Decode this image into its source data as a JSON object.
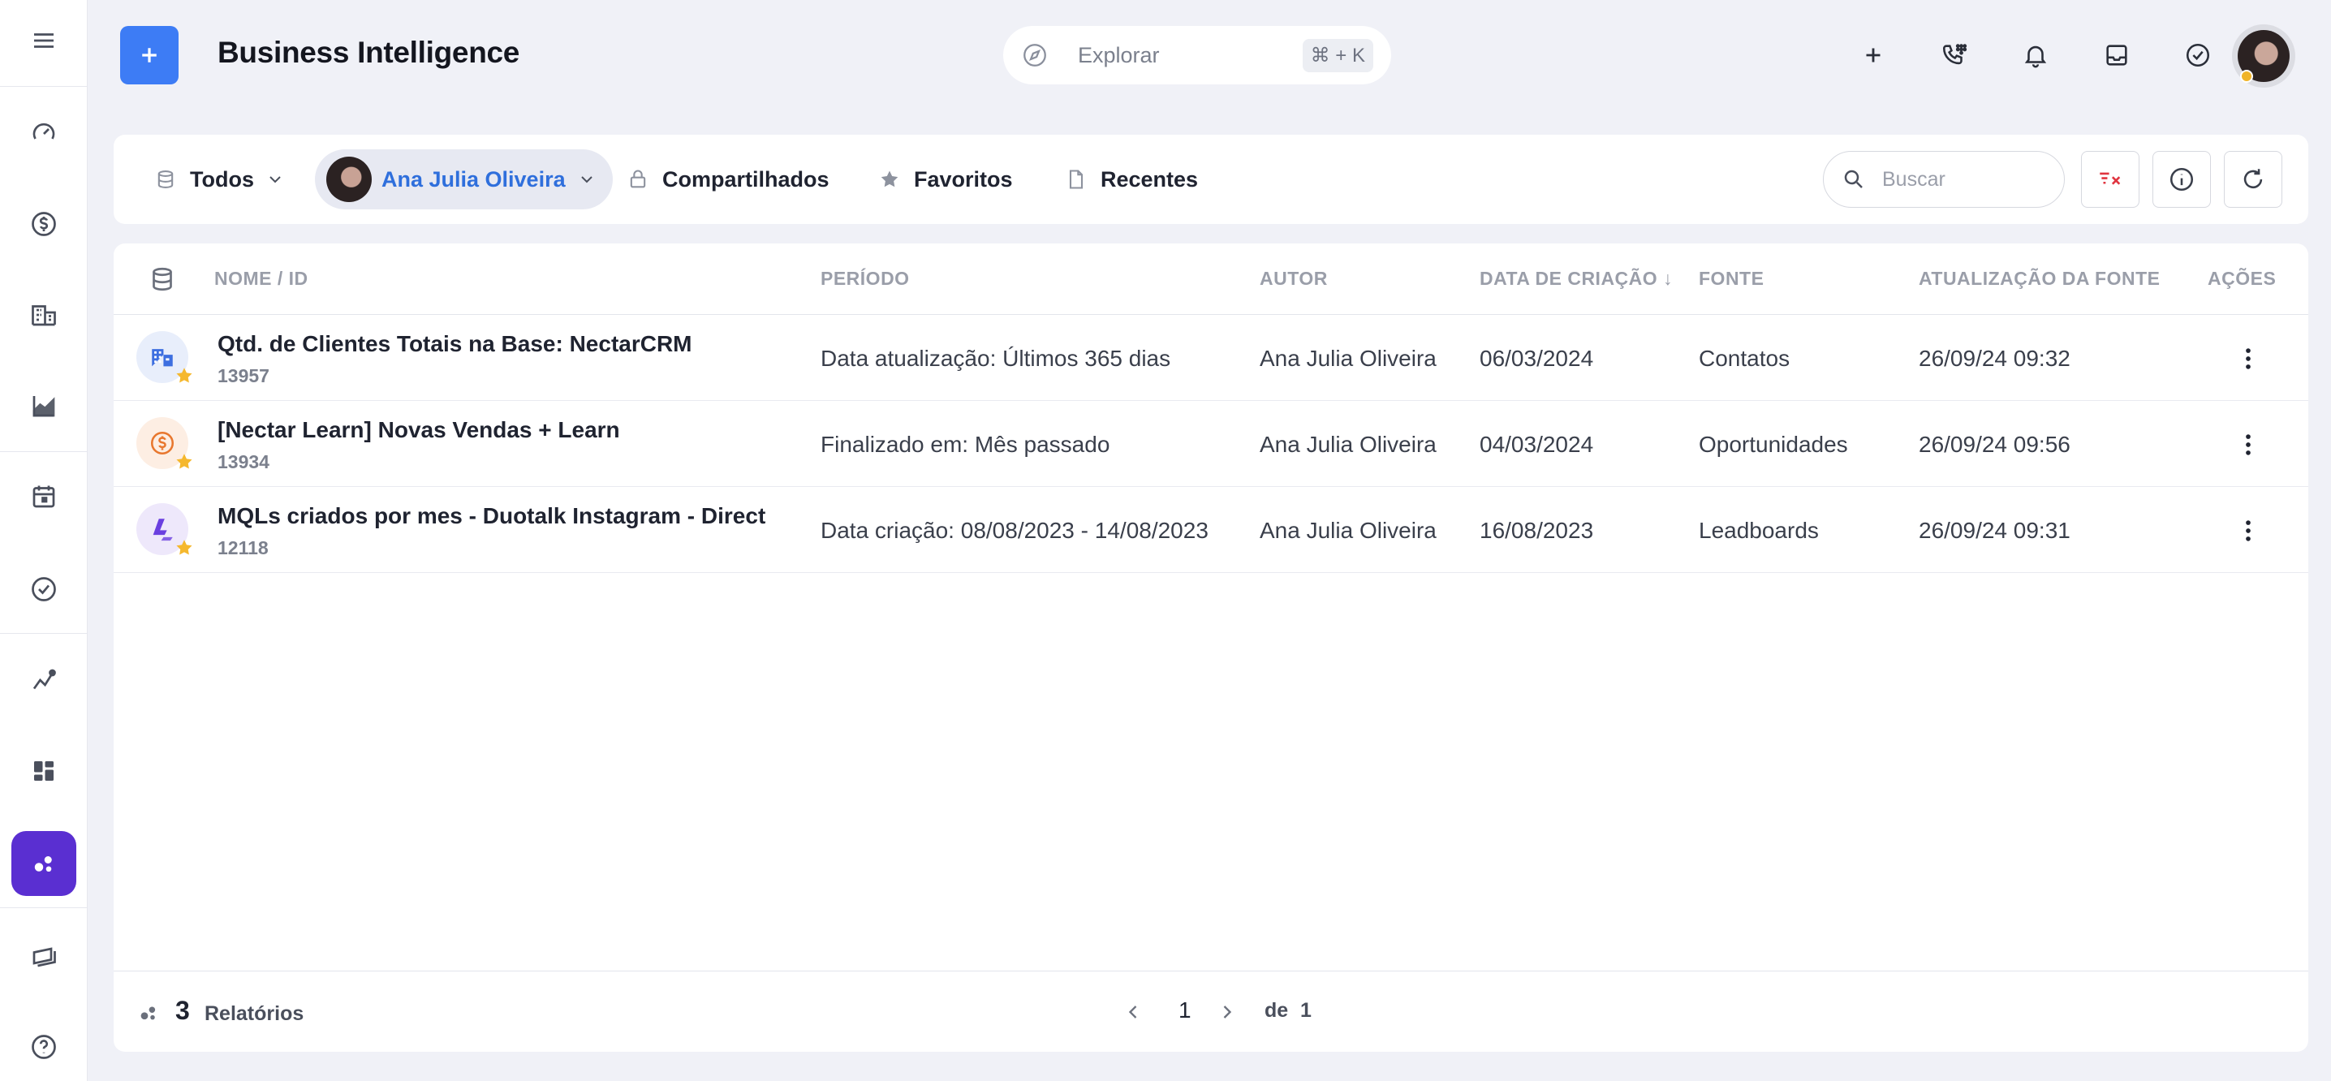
{
  "app": {
    "title": "Business Intelligence"
  },
  "explore": {
    "placeholder": "Explorar",
    "shortcut": "⌘ + K"
  },
  "filters": {
    "all_label": "Todos",
    "user_label": "Ana Julia Oliveira",
    "shared_label": "Compartilhados",
    "favorites_label": "Favoritos",
    "recent_label": "Recentes",
    "search_placeholder": "Buscar"
  },
  "table": {
    "columns": [
      "NOME / ID",
      "PERÍODO",
      "AUTOR",
      "DATA DE CRIAÇÃO ↓",
      "FONTE",
      "ATUALIZAÇÃO DA FONTE",
      "AÇÕES"
    ],
    "rows": [
      {
        "name": "Qtd. de Clientes Totais na Base: NectarCRM",
        "id": "13957",
        "period": "Data atualização: Últimos 365 dias",
        "author": "Ana Julia Oliveira",
        "created": "06/03/2024",
        "source": "Contatos",
        "updated": "26/09/24 09:32",
        "icon": "building-icon",
        "icon_color": "#3d6fe0",
        "icon_bg": "#e8eefb"
      },
      {
        "name": "[Nectar Learn] Novas Vendas + Learn",
        "id": "13934",
        "period": "Finalizado em: Mês passado",
        "author": "Ana Julia Oliveira",
        "created": "04/03/2024",
        "source": "Oportunidades",
        "updated": "26/09/24 09:56",
        "icon": "dollar-icon",
        "icon_color": "#e8772e",
        "icon_bg": "#fdeee3"
      },
      {
        "name": "MQLs criados por mes - Duotalk Instagram - Direct",
        "id": "12118",
        "period": "Data criação: 08/08/2023 - 14/08/2023",
        "author": "Ana Julia Oliveira",
        "created": "16/08/2023",
        "source": "Leadboards",
        "updated": "26/09/24 09:31",
        "icon": "lead-icon",
        "icon_color": "#6a3fe0",
        "icon_bg": "#eee8fb"
      }
    ]
  },
  "footer": {
    "count": "3",
    "label": "Relatórios",
    "page": "1",
    "of_label": "de",
    "total_pages": "1"
  },
  "colors": {
    "accent": "#3d7cf5",
    "active_nav": "#5a2fd1",
    "link": "#2f6fdc",
    "danger": "#e0343f",
    "star": "#f5b82e"
  }
}
